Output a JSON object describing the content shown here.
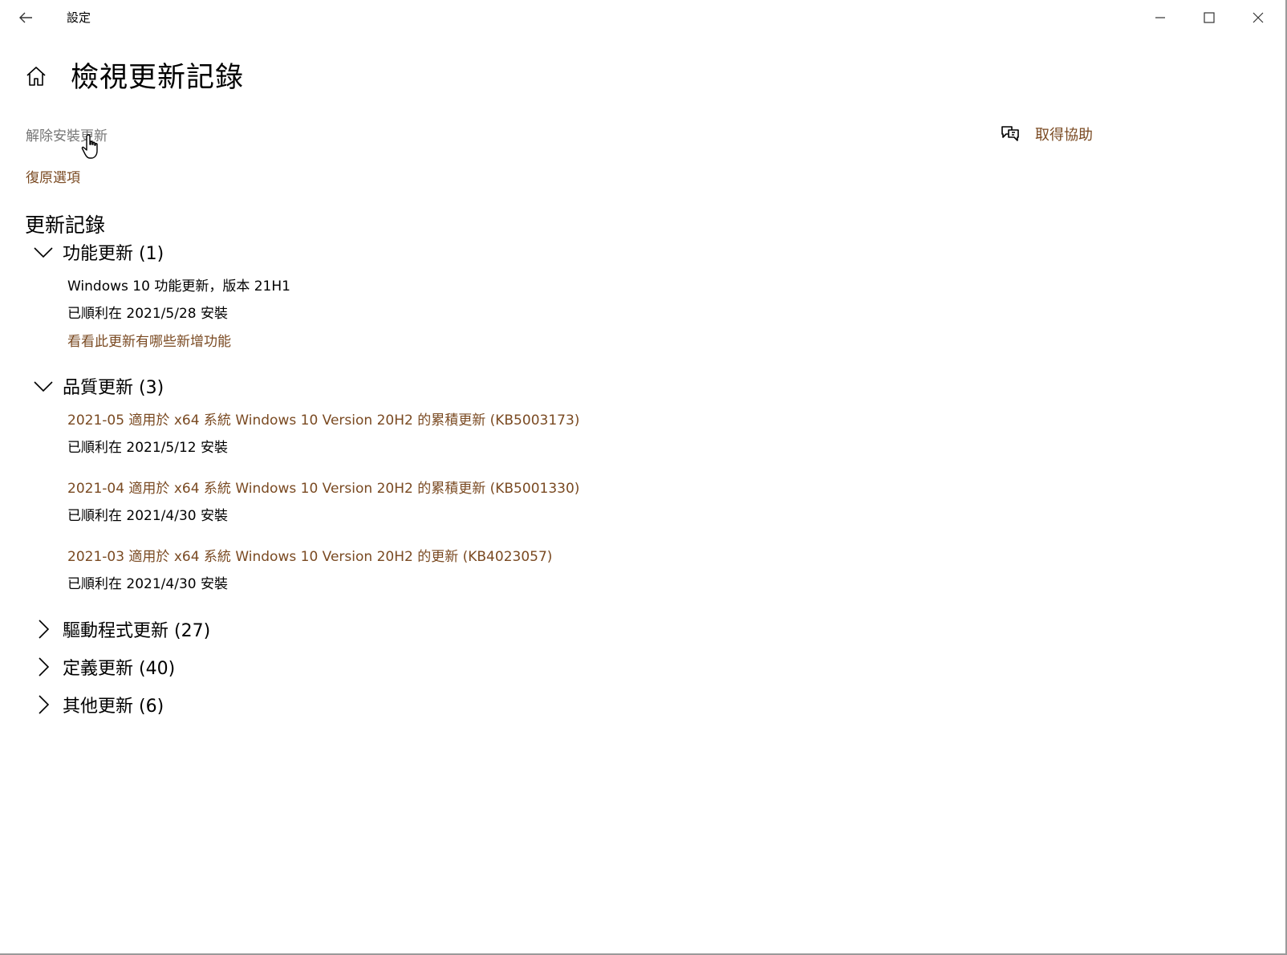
{
  "window": {
    "title": "設定"
  },
  "header": {
    "title": "檢視更新記錄"
  },
  "links": {
    "uninstall": "解除安裝更新",
    "recovery": "復原選項",
    "help": "取得協助"
  },
  "history": {
    "title": "更新記錄",
    "feature": {
      "label": "功能更新 (1)",
      "expanded": true,
      "items": [
        {
          "name": "Windows 10 功能更新，版本 21H1",
          "status": "已順利在 2021/5/28 安裝",
          "link": "看看此更新有哪些新增功能"
        }
      ]
    },
    "quality": {
      "label": "品質更新 (3)",
      "expanded": true,
      "items": [
        {
          "name": "2021-05 適用於 x64 系統 Windows 10 Version 20H2 的累積更新 (KB5003173)",
          "status": "已順利在 2021/5/12 安裝"
        },
        {
          "name": "2021-04 適用於 x64 系統 Windows 10 Version 20H2 的累積更新 (KB5001330)",
          "status": "已順利在 2021/4/30 安裝"
        },
        {
          "name": "2021-03 適用於 x64 系統 Windows 10 Version 20H2 的更新 (KB4023057)",
          "status": "已順利在 2021/4/30 安裝"
        }
      ]
    },
    "driver": {
      "label": "驅動程式更新 (27)",
      "expanded": false
    },
    "definition": {
      "label": "定義更新 (40)",
      "expanded": false
    },
    "other": {
      "label": "其他更新 (6)",
      "expanded": false
    }
  },
  "icons": {
    "back": "back-arrow-icon",
    "home": "home-icon",
    "help": "chat-help-icon",
    "minimize": "minimize-icon",
    "maximize": "maximize-icon",
    "close": "close-icon",
    "expanded": "chevron-down-icon",
    "collapsed": "chevron-right-icon"
  },
  "colors": {
    "accent": "#7a4a22",
    "muted": "#767676",
    "text": "#000000"
  }
}
